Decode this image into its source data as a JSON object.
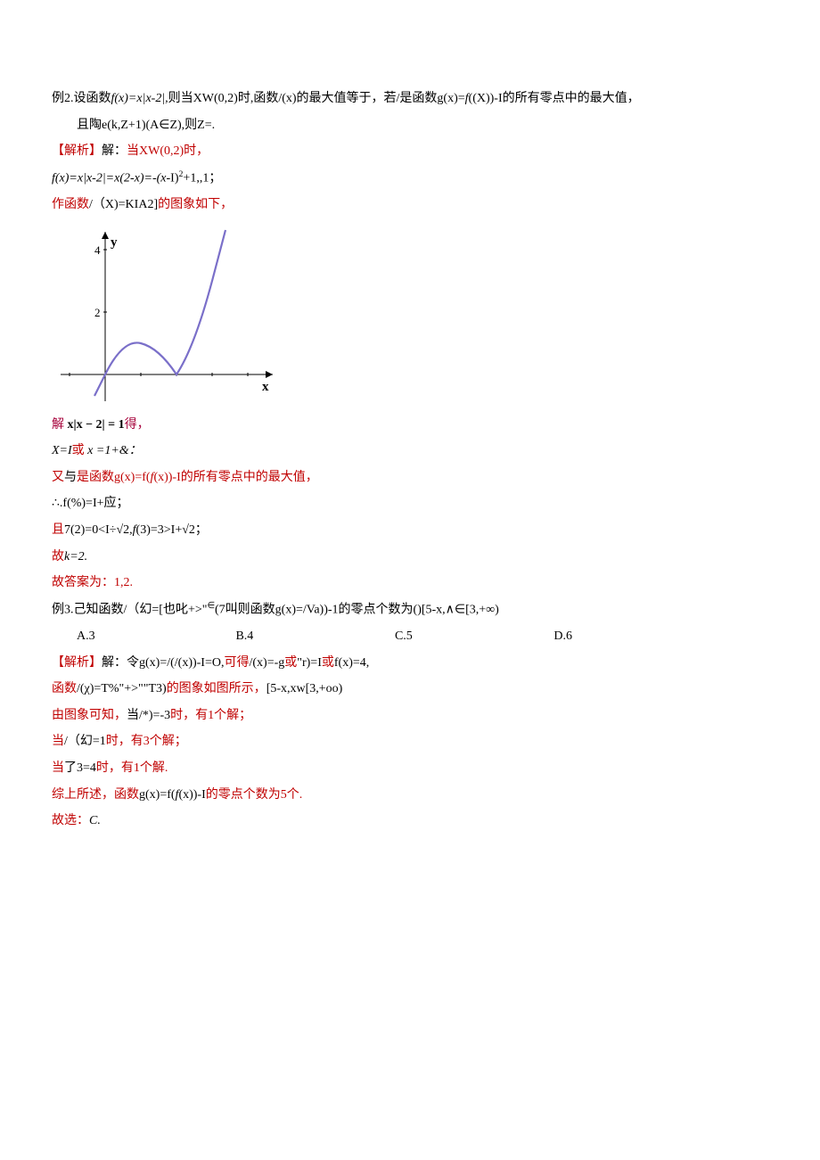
{
  "p1": "例2.设函数",
  "p1b": "f(x)=x|x-2|,",
  "p1c": "则当XW(0,2)时,函数/(x)的最大值等于，若/是函数g(x)=",
  "p1d": "f",
  "p1e": "((X))-I的所有零点中的最大值，",
  "p2": "且陶e(k,Z+1)(A∈Z),则Z=.",
  "p3a": "【解析】",
  "p3b": "解：",
  "p3c": "当XW(0,2)时，",
  "p4a": "f(x)=x|x-2|=x(2-x)=-(x",
  "p4b": "-I)",
  "p4c": "2",
  "p4d": "+1,,1；",
  "p5a": "作函数",
  "p5b": "/（X)=KIA2]",
  "p5c": "的图象如下，",
  "p6a": "解",
  "p6b": " x|x − 2| = 1",
  "p6c": "得，",
  "p7": "X=I",
  "p7b": "或",
  "p7c": " x =1+&：",
  "p8a": "又",
  "p8b": "与",
  "p8c": "是函数g(x)=f(",
  "p8d": "f",
  "p8e": "(x))-I的所有零点中的最大值，",
  "p9": "∴.f(%)=I+应；",
  "p10a": "且",
  "p10b": "7(2)=0<I÷√2,",
  "p10c": "f",
  "p10d": "(3)=3>I+√2；",
  "p11a": "故",
  "p11b": "k=2.",
  "p12": "故答案为：1,2.",
  "p13a": "例3.己知函数/（幻=[也叱+>\"",
  "p13b": "∈",
  "p13c": "(7叫则函数g(x)=/Va))-1的零点个数为()[5-x,∧∈[3,+∞)",
  "optA": "A.3",
  "optB": "B.4",
  "optC": "C.5",
  "optD": "D.6",
  "p14a": "【解析】",
  "p14b": "解：令",
  "p14c": "g(x)=/(/(x))-I=O,",
  "p14d": "可得",
  "p14e": "/(x)=-g",
  "p14f": "或",
  "p14g": "\"r)=I",
  "p14h": "或",
  "p14i": "f(x)=4,",
  "p15a": "函数",
  "p15b": "/(χ)=T%\"+>\"\"T3)",
  "p15c": "的图象如图所示，",
  "p15d": "[5-x,xw[3,+oo)",
  "p16a": "由图象可知，",
  "p16b": "当/*)=-3",
  "p16c": "时，有1个解；",
  "p17a": "当",
  "p17b": "/（幻=1",
  "p17c": "时，有3个解；",
  "p18a": "当",
  "p18b": "了3=4",
  "p18c": "时，有1个解.",
  "p19a": "综上所述，函数",
  "p19b": "g(x)=f(",
  "p19c": "f",
  "p19d": "(x))-I",
  "p19e": "的零点个数为5个.",
  "p20a": "故选：",
  "p20b": "C.",
  "chart_data": {
    "type": "line",
    "title": "",
    "xlabel": "x",
    "ylabel": "y",
    "xlim": [
      -1,
      4
    ],
    "ylim": [
      -1,
      5
    ],
    "yticks": [
      2,
      4
    ],
    "series": [
      {
        "name": "f(x)=x|x-2|",
        "x": [
          -0.3,
          0,
          0.5,
          1,
          1.5,
          2,
          2.5,
          3,
          3.3
        ],
        "y": [
          -0.69,
          0,
          0.75,
          1,
          0.75,
          0,
          1.25,
          3,
          4.29
        ]
      }
    ]
  }
}
